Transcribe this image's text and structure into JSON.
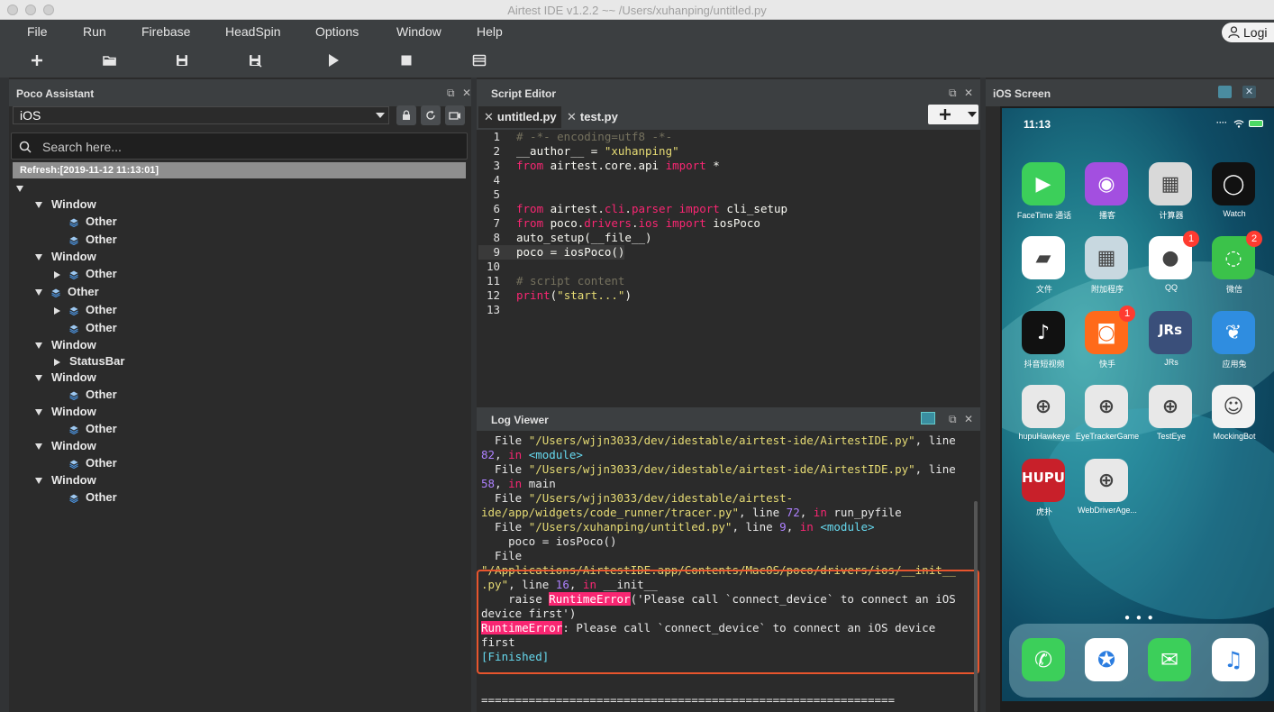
{
  "window": {
    "title": "Airtest IDE v1.2.2 ~~ /Users/xuhanping/untitled.py"
  },
  "menu": [
    "File",
    "Run",
    "Firebase",
    "HeadSpin",
    "Options",
    "Window",
    "Help"
  ],
  "login_label": "Logi",
  "toolbar": {
    "icons": [
      "new-file-icon",
      "open-folder-icon",
      "save-icon",
      "save-as-icon",
      "run-icon",
      "stop-icon",
      "log-list-icon"
    ]
  },
  "poco": {
    "title": "Poco Assistant",
    "platform": "iOS",
    "search_placeholder": "Search here...",
    "refresh": "Refresh:[2019-11-12 11:13:01]",
    "tree": [
      {
        "label": "",
        "indent": 0,
        "toggle": "down",
        "icon": false
      },
      {
        "label": "Window",
        "indent": 1,
        "toggle": "down",
        "icon": false
      },
      {
        "label": "Other",
        "indent": 2,
        "toggle": "none",
        "icon": true
      },
      {
        "label": "Other",
        "indent": 2,
        "toggle": "none",
        "icon": true
      },
      {
        "label": "Window",
        "indent": 1,
        "toggle": "down",
        "icon": false
      },
      {
        "label": "Other",
        "indent": 2,
        "toggle": "right",
        "icon": true
      },
      {
        "label": "Other",
        "indent": 1,
        "toggle": "down",
        "icon": true
      },
      {
        "label": "Other",
        "indent": 2,
        "toggle": "right",
        "icon": true
      },
      {
        "label": "Other",
        "indent": 2,
        "toggle": "none",
        "icon": true
      },
      {
        "label": "Window",
        "indent": 1,
        "toggle": "down",
        "icon": false
      },
      {
        "label": "StatusBar",
        "indent": 2,
        "toggle": "right",
        "icon": false
      },
      {
        "label": "Window",
        "indent": 1,
        "toggle": "down",
        "icon": false
      },
      {
        "label": "Other",
        "indent": 2,
        "toggle": "none",
        "icon": true
      },
      {
        "label": "Window",
        "indent": 1,
        "toggle": "down",
        "icon": false
      },
      {
        "label": "Other",
        "indent": 2,
        "toggle": "none",
        "icon": true
      },
      {
        "label": "Window",
        "indent": 1,
        "toggle": "down",
        "icon": false
      },
      {
        "label": "Other",
        "indent": 2,
        "toggle": "none",
        "icon": true
      },
      {
        "label": "Window",
        "indent": 1,
        "toggle": "down",
        "icon": false
      },
      {
        "label": "Other",
        "indent": 2,
        "toggle": "none",
        "icon": true
      }
    ]
  },
  "editor": {
    "title": "Script Editor",
    "tabs": [
      "untitled.py",
      "test.py"
    ],
    "lines": [
      [
        [
          "c-com",
          "# -*- encoding=utf8 -*-"
        ]
      ],
      [
        [
          "c-txt",
          "__author__ = "
        ],
        [
          "c-str",
          "\"xuhanping\""
        ]
      ],
      [
        [
          "c-kw",
          "from"
        ],
        [
          "c-txt",
          " airtest.core.api "
        ],
        [
          "c-kw",
          "import"
        ],
        [
          "c-txt",
          " *"
        ]
      ],
      [],
      [],
      [
        [
          "c-kw",
          "from"
        ],
        [
          "c-txt",
          " airtest."
        ],
        [
          "c-kw",
          "cli"
        ],
        [
          "c-txt",
          "."
        ],
        [
          "c-kw",
          "parser"
        ],
        [
          "c-txt",
          " "
        ],
        [
          "c-kw",
          "import"
        ],
        [
          "c-txt",
          " cli_setup"
        ]
      ],
      [
        [
          "c-kw",
          "from"
        ],
        [
          "c-txt",
          " poco."
        ],
        [
          "c-kw",
          "drivers"
        ],
        [
          "c-txt",
          "."
        ],
        [
          "c-kw",
          "ios"
        ],
        [
          "c-txt",
          " "
        ],
        [
          "c-kw",
          "import"
        ],
        [
          "c-txt",
          " iosPoco"
        ]
      ],
      [
        [
          "c-txt",
          "auto_setup(__file__)"
        ]
      ],
      [
        [
          "c-txt",
          "poco = iosPoco()"
        ]
      ],
      [],
      [
        [
          "c-com",
          "# script content"
        ]
      ],
      [
        [
          "c-kw",
          "print"
        ],
        [
          "c-txt",
          "("
        ],
        [
          "c-str",
          "\"start...\""
        ],
        [
          "c-txt",
          ")"
        ]
      ],
      []
    ]
  },
  "log": {
    "title": "Log Viewer",
    "lines": [
      [
        [
          "",
          "  File "
        ],
        [
          "l-str",
          "\"/Users/wjjn3033/dev/idestable/airtest-ide/AirtestIDE.py\""
        ],
        [
          "",
          ", line"
        ]
      ],
      [
        [
          "l-num",
          "82"
        ],
        [
          "",
          ", "
        ],
        [
          "l-kw",
          "in"
        ],
        [
          "",
          " "
        ],
        [
          "l-mod",
          "<module>"
        ]
      ],
      [
        [
          "",
          "  File "
        ],
        [
          "l-str",
          "\"/Users/wjjn3033/dev/idestable/airtest-ide/AirtestIDE.py\""
        ],
        [
          "",
          ", line"
        ]
      ],
      [
        [
          "l-num",
          "58"
        ],
        [
          "",
          ", "
        ],
        [
          "l-kw",
          "in"
        ],
        [
          "",
          " main"
        ]
      ],
      [
        [
          "",
          "  File "
        ],
        [
          "l-str",
          "\"/Users/wjjn3033/dev/idestable/airtest-"
        ]
      ],
      [
        [
          "l-str",
          "ide/app/widgets/code_runner/tracer.py\""
        ],
        [
          "",
          ", line "
        ],
        [
          "l-num",
          "72"
        ],
        [
          "",
          ", "
        ],
        [
          "l-kw",
          "in"
        ],
        [
          "",
          " run_pyfile"
        ]
      ],
      [
        [
          "",
          "  File "
        ],
        [
          "l-str",
          "\"/Users/xuhanping/untitled.py\""
        ],
        [
          "",
          ", line "
        ],
        [
          "l-num",
          "9"
        ],
        [
          "",
          ", "
        ],
        [
          "l-kw",
          "in"
        ],
        [
          "",
          " "
        ],
        [
          "l-mod",
          "<module>"
        ]
      ],
      [
        [
          "",
          "    poco = iosPoco()"
        ]
      ],
      [
        [
          "",
          "  File"
        ]
      ],
      [
        [
          "l-str",
          "\"/Applications/AirtestIDE.app/Contents/MacOS/poco/drivers/ios/__init__"
        ]
      ],
      [
        [
          "l-str",
          ".py\""
        ],
        [
          "",
          ", line "
        ],
        [
          "l-num",
          "16"
        ],
        [
          "",
          ", "
        ],
        [
          "l-kw",
          "in"
        ],
        [
          "",
          " __init__"
        ]
      ],
      [
        [
          "",
          "    raise "
        ],
        [
          "l-err",
          "RuntimeError"
        ],
        [
          "",
          "('Please call `connect_device` to connect an iOS"
        ]
      ],
      [
        [
          "",
          "device first')"
        ]
      ],
      [
        [
          "l-err",
          "RuntimeError"
        ],
        [
          "",
          ": Please call `connect_device` to connect an iOS device"
        ]
      ],
      [
        [
          "",
          "first"
        ]
      ],
      [
        [
          "l-fin",
          "[Finished]"
        ]
      ],
      [],
      [],
      [
        [
          "",
          "============================================================="
        ]
      ]
    ]
  },
  "ios": {
    "title": "iOS Screen",
    "time": "11:13",
    "apps": [
      {
        "label": "FaceTime 通话",
        "color": "#3ccf5a",
        "glyph": "▶",
        "badge": ""
      },
      {
        "label": "播客",
        "color": "#a34fe0",
        "glyph": "◉",
        "badge": ""
      },
      {
        "label": "计算器",
        "color": "#d9d9d9",
        "glyph": "▦",
        "badge": ""
      },
      {
        "label": "Watch",
        "color": "#111111",
        "glyph": "◯",
        "badge": ""
      },
      {
        "label": "文件",
        "color": "#ffffff",
        "glyph": "▰",
        "badge": ""
      },
      {
        "label": "附加程序",
        "color": "#c8d8e0",
        "glyph": "▦",
        "badge": ""
      },
      {
        "label": "QQ",
        "color": "#ffffff",
        "glyph": "●",
        "badge": "1"
      },
      {
        "label": "微信",
        "color": "#3bc24a",
        "glyph": "◌",
        "badge": "2"
      },
      {
        "label": "抖音短视频",
        "color": "#111111",
        "glyph": "♪",
        "badge": ""
      },
      {
        "label": "快手",
        "color": "#ff6a1a",
        "glyph": "◙",
        "badge": "1"
      },
      {
        "label": "JRs",
        "color": "#3a4f7a",
        "glyph": "JRs",
        "badge": ""
      },
      {
        "label": "应用兔",
        "color": "#2f8de0",
        "glyph": "❦",
        "badge": ""
      },
      {
        "label": "hupuHawkeye",
        "color": "#e8e8e8",
        "glyph": "⊕",
        "badge": ""
      },
      {
        "label": "EyeTrackerGame",
        "color": "#e8e8e8",
        "glyph": "⊕",
        "badge": ""
      },
      {
        "label": "TestEye",
        "color": "#e8e8e8",
        "glyph": "⊕",
        "badge": ""
      },
      {
        "label": "MockingBot",
        "color": "#f2f2f2",
        "glyph": "☺",
        "badge": ""
      },
      {
        "label": "虎扑",
        "color": "#c8202a",
        "glyph": "HUPU",
        "badge": ""
      },
      {
        "label": "WebDriverAge...",
        "color": "#e8e8e8",
        "glyph": "⊕",
        "badge": ""
      }
    ],
    "dock": [
      {
        "name": "phone",
        "color": "#3ccf5a",
        "glyph": "✆"
      },
      {
        "name": "safari",
        "color": "#ffffff",
        "glyph": "✪"
      },
      {
        "name": "messages",
        "color": "#3ccf5a",
        "glyph": "✉"
      },
      {
        "name": "music",
        "color": "#ffffff",
        "glyph": "♫"
      }
    ]
  }
}
